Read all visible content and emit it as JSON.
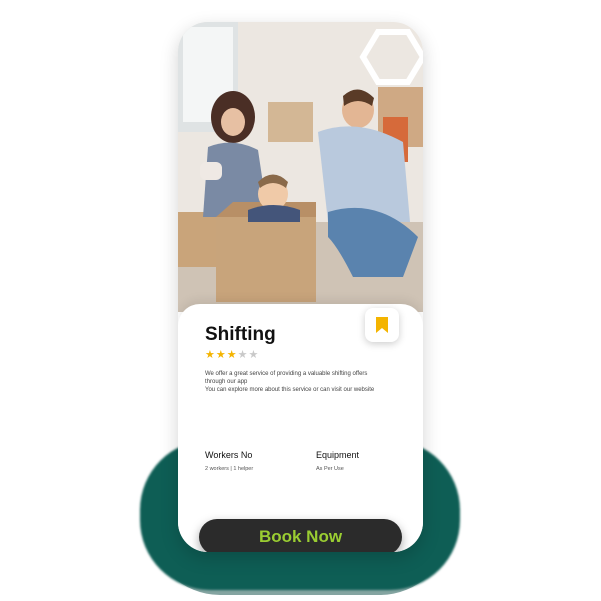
{
  "service": {
    "title": "Shifting",
    "rating_filled": 3,
    "rating_total": 5,
    "description_lines": [
      "We offer a great service of providing a  valuable  shifting offers",
      "through our app",
      "You can explore more about this service or can visit our website"
    ]
  },
  "info": {
    "workers_label": "Workers No",
    "workers_value": "2 workers  |  1 helper",
    "equipment_label": "Equipment",
    "equipment_value": "As Per Use"
  },
  "actions": {
    "book_label": "Book Now"
  },
  "colors": {
    "accent_green": "#9acd32",
    "teal": "#0e5e55",
    "bookmark": "#f4b400",
    "button_bg": "#2b2b2b"
  },
  "icons": {
    "bookmark": "bookmark-icon",
    "star": "star-icon"
  }
}
